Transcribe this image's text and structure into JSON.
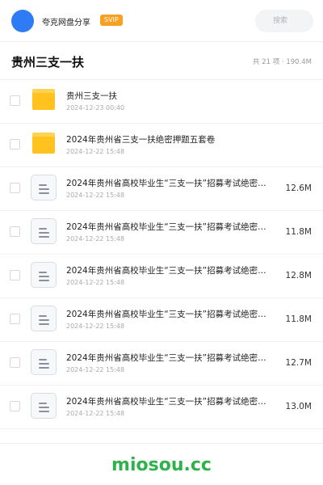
{
  "header": {
    "account_name": "夸克网盘分享",
    "badge": "SVIP",
    "search_placeholder": "搜索",
    "avatar_color": "#2f7bf6"
  },
  "titlebar": {
    "title": "贵州三支一扶",
    "summary": "共 21 项 · 190.4M"
  },
  "files": [
    {
      "type": "folder",
      "icon": "folder-icon",
      "name": "贵州三支一扶",
      "date": "2024-12-23 00:40",
      "size": ""
    },
    {
      "type": "folder",
      "icon": "folder-icon",
      "name": "2024年贵州省三支一扶绝密押题五套卷",
      "date": "2024-12-22 15:48",
      "size": ""
    },
    {
      "type": "doc",
      "icon": "document-icon",
      "name": "2024年贵州省高校毕业生“三支一扶”招募考试绝密…",
      "date": "2024-12-22 15:48",
      "size": "12.6M"
    },
    {
      "type": "doc",
      "icon": "document-icon",
      "name": "2024年贵州省高校毕业生“三支一扶”招募考试绝密…",
      "date": "2024-12-22 15:48",
      "size": "11.8M"
    },
    {
      "type": "doc",
      "icon": "document-icon",
      "name": "2024年贵州省高校毕业生“三支一扶”招募考试绝密…",
      "date": "2024-12-22 15:48",
      "size": "12.8M"
    },
    {
      "type": "doc",
      "icon": "document-icon",
      "name": "2024年贵州省高校毕业生“三支一扶”招募考试绝密…",
      "date": "2024-12-22 15:48",
      "size": "11.8M"
    },
    {
      "type": "doc",
      "icon": "document-icon",
      "name": "2024年贵州省高校毕业生“三支一扶”招募考试绝密…",
      "date": "2024-12-22 15:48",
      "size": "12.7M"
    },
    {
      "type": "doc",
      "icon": "document-icon",
      "name": "2024年贵州省高校毕业生“三支一扶”招募考试绝密…",
      "date": "2024-12-22 15:48",
      "size": "13.0M"
    }
  ],
  "footer": {
    "watermark": "miosou.cc",
    "watermark_color": "#2fb24c"
  }
}
